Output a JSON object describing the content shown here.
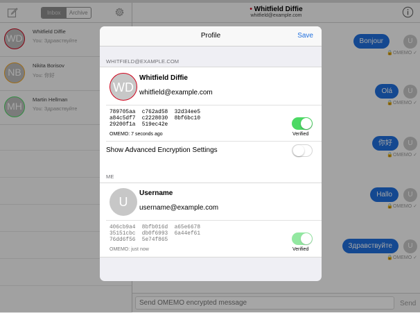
{
  "sidebar": {
    "tabs": [
      {
        "label": "Inbox"
      },
      {
        "label": "Archive"
      }
    ],
    "contacts": [
      {
        "initials": "WD",
        "name": "Whitfield Diffie",
        "preview": "You: Здравствуйте",
        "color": "#d0021b"
      },
      {
        "initials": "NB",
        "name": "Nikita Borisov",
        "preview": "You: 你好",
        "color": "#f5a623"
      },
      {
        "initials": "MH",
        "name": "Martin Hellman",
        "preview": "You: Здравствуйте",
        "color": "#4cd964"
      }
    ]
  },
  "chat": {
    "title": "Whitfield Diffie",
    "subtitle": "whitfield@example.com",
    "messages": [
      {
        "text": "Bonjour",
        "status": "OMEMO ✓"
      },
      {
        "text": "Olá",
        "status": "OMEMO ✓"
      },
      {
        "text": "你好",
        "status": "OMEMO ✓"
      },
      {
        "text": "Hallo",
        "status": "OMEMO ✓"
      },
      {
        "text": "Здравствуйте",
        "status": "OMEMO ✓"
      }
    ],
    "user_initial": "U",
    "input_placeholder": "Send OMEMO encrypted message",
    "send_label": "Send"
  },
  "profile": {
    "title": "Profile",
    "save_label": "Save",
    "contact_section": "WHITFIELD@EXAMPLE.COM",
    "contact": {
      "initials": "WD",
      "name": "Whitfield Diffie",
      "email": "whitfield@example.com",
      "fingerprint": "789705aa  c762ad58  32d34ee5\na84c5df7  c2228030  8bf6bc10\n29200f1a  519ec42e",
      "omemo_status": "OMEMO: 7 seconds ago",
      "verified_label": "Verified",
      "verified": true
    },
    "advanced_label": "Show Advanced Encryption Settings",
    "advanced_enabled": false,
    "me_section": "ME",
    "me": {
      "initial": "U",
      "name": "Username",
      "email": "username@example.com",
      "fingerprint": "406cb9a4  8bfb016d  a65e6678\n35151cbc  db0f6993  6a44ef61\n76dd6f56  5e74f865",
      "omemo_status": "OMEMO: just now",
      "verified_label": "Verified",
      "verified": true
    }
  },
  "colors": {
    "accent": "#1f6fde",
    "toggle_on": "#4cd964",
    "unread_dot": "#d0021b"
  }
}
